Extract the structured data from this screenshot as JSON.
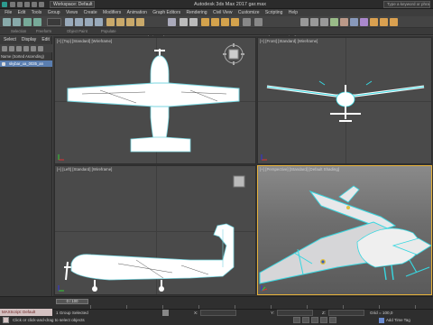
{
  "title": {
    "workspace": "Workspace: Default",
    "app": "Autodesk 3ds Max 2017     gar.max",
    "search_placeholder": "Type a keyword or phrase"
  },
  "menu": [
    "File",
    "Edit",
    "Tools",
    "Group",
    "Views",
    "Create",
    "Modifiers",
    "Animation",
    "Graph Editors",
    "Rendering",
    "Civil View",
    "Customize",
    "Scripting",
    "Help"
  ],
  "toolbar": {
    "view_label": "View",
    "selection_set": "Create Selection Set"
  },
  "ribbon": [
    "Selection",
    "Freeform",
    "Object Paint",
    "Populate"
  ],
  "scene_explorer": {
    "tabs": [
      "Select",
      "Display",
      "Edit"
    ],
    "header": "Name (Sorted Ascending)",
    "row_label": "skybar_ua_0035_an"
  },
  "viewports": {
    "top": "[+] [Top] [Standard] [Wireframe]",
    "front": "[+] [Front] [Standard] [Wireframe]",
    "left": "[+] [Left] [Standard] [Wireframe]",
    "perspective": "[+] [Perspective] [Standard] [Default Shading]"
  },
  "timeline": {
    "slider": "0 / 100"
  },
  "status": {
    "maxscript": "MAXScript: Default",
    "selection": "1 Group Selected",
    "prompt": "Click or click-and-drag to select objects",
    "x_label": "X:",
    "y_label": "Y:",
    "z_label": "Z:",
    "grid": "Grid = 100,0",
    "add_time_tag": "Add Time Tag"
  },
  "colors": {
    "accent": "#e7b23a",
    "wire": "#ffffff",
    "outline": "#37d7e0",
    "selection_row": "#5a7eb0"
  }
}
